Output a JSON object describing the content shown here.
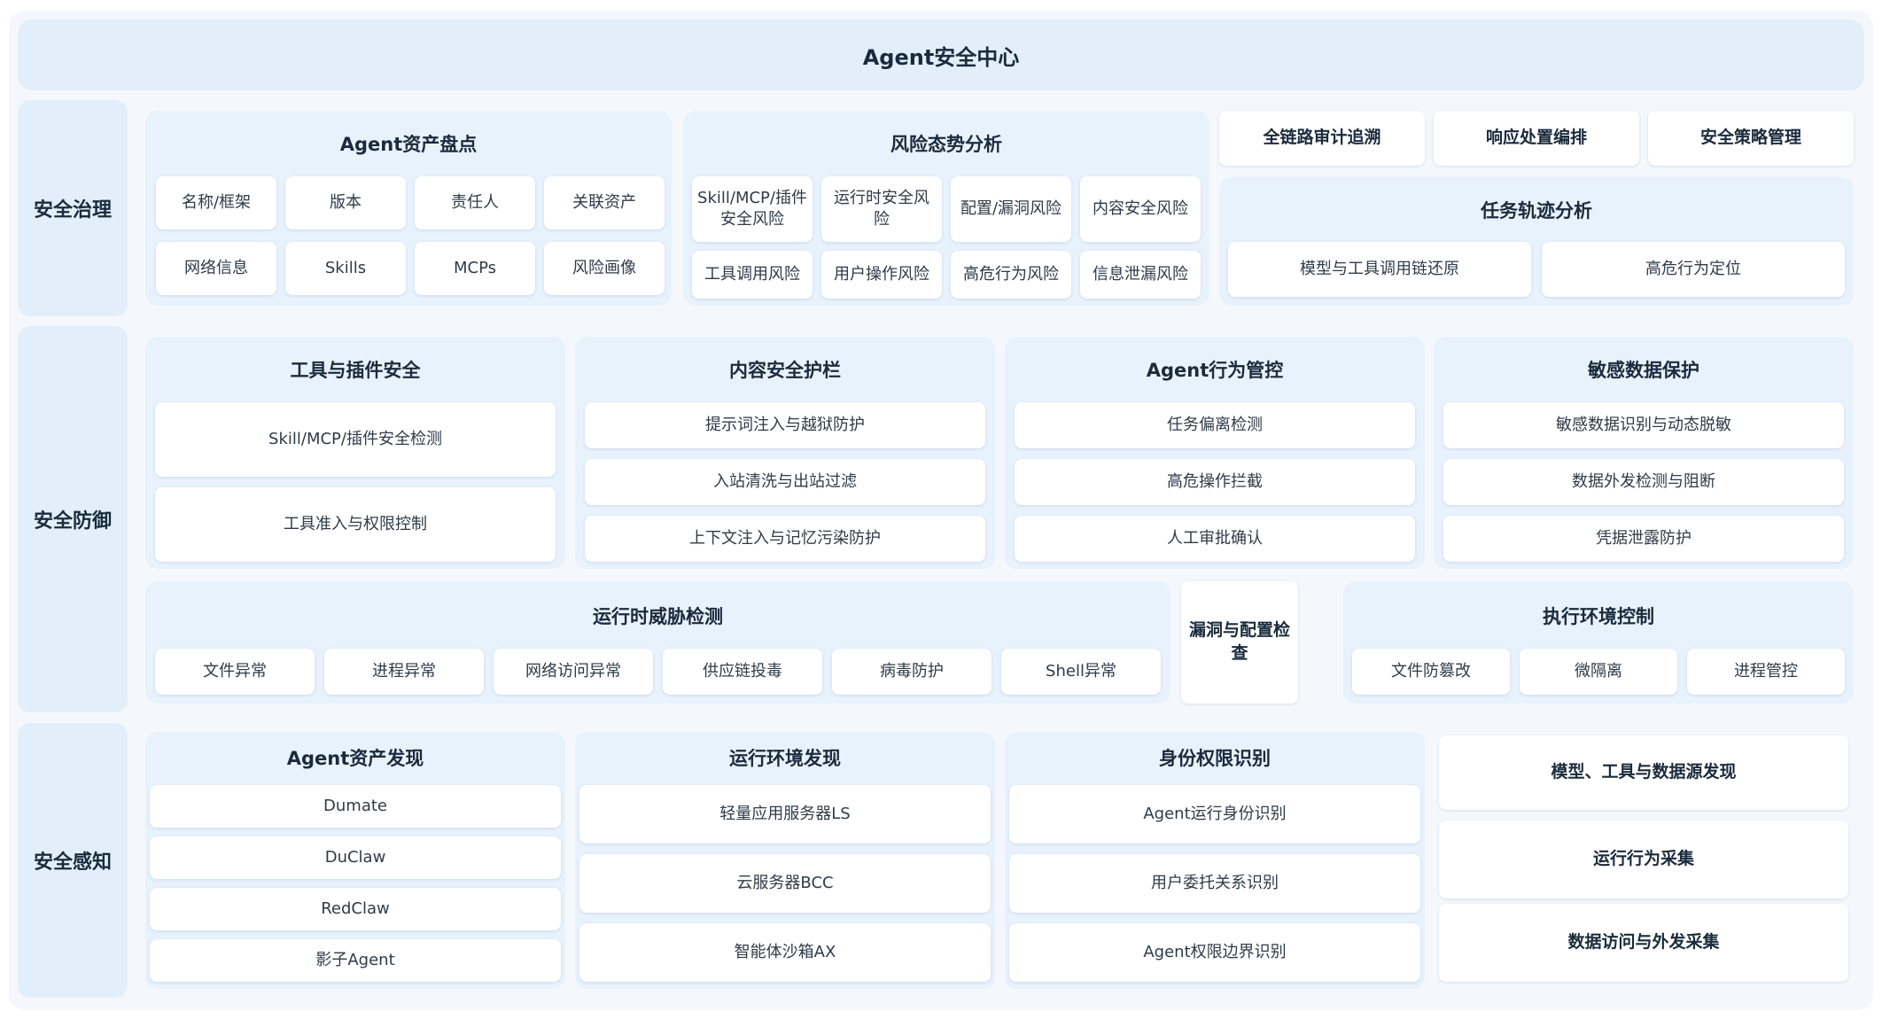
{
  "title": "Agent安全中心",
  "governance": {
    "label": "安全治理",
    "assets": {
      "title": "Agent资产盘点",
      "items": [
        "名称/框架",
        "版本",
        "责任人",
        "关联资产",
        "网络信息",
        "Skills",
        "MCPs",
        "风险画像"
      ]
    },
    "risk": {
      "title": "风险态势分析",
      "items": [
        "Skill/MCP/插件安全风险",
        "运行时安全风险",
        "配置/漏洞风险",
        "内容安全风险",
        "工具调用风险",
        "用户操作风险",
        "高危行为风险",
        "信息泄漏风险"
      ]
    },
    "top_buttons": [
      "全链路审计追溯",
      "响应处置编排",
      "安全策略管理"
    ],
    "trace": {
      "title": "任务轨迹分析",
      "items": [
        "模型与工具调用链还原",
        "高危行为定位"
      ]
    }
  },
  "defense": {
    "label": "安全防御",
    "tools": {
      "title": "工具与插件安全",
      "items": [
        "Skill/MCP/插件安全检测",
        "工具准入与权限控制"
      ]
    },
    "content": {
      "title": "内容安全护栏",
      "items": [
        "提示词注入与越狱防护",
        "入站清洗与出站过滤",
        "上下文注入与记忆污染防护"
      ]
    },
    "behavior": {
      "title": "Agent行为管控",
      "items": [
        "任务偏离检测",
        "高危操作拦截",
        "人工审批确认"
      ]
    },
    "sensitive": {
      "title": "敏感数据保护",
      "items": [
        "敏感数据识别与动态脱敏",
        "数据外发检测与阻断",
        "凭据泄露防护"
      ]
    },
    "runtime": {
      "title": "运行时威胁检测",
      "items": [
        "文件异常",
        "进程异常",
        "网络访问异常",
        "供应链投毒",
        "病毒防护",
        "Shell异常"
      ]
    },
    "vuln": "漏洞与配置检查",
    "env": {
      "title": "执行环境控制",
      "items": [
        "文件防篡改",
        "微隔离",
        "进程管控"
      ]
    }
  },
  "perception": {
    "label": "安全感知",
    "discovery": {
      "title": "Agent资产发现",
      "items": [
        "Dumate",
        "DuClaw",
        "RedClaw",
        "影子Agent"
      ]
    },
    "env_discovery": {
      "title": "运行环境发现",
      "items": [
        "轻量应用服务器LS",
        "云服务器BCC",
        "智能体沙箱AX"
      ]
    },
    "identity": {
      "title": "身份权限识别",
      "items": [
        "Agent运行身份识别",
        "用户委托关系识别",
        "Agent权限边界识别"
      ]
    },
    "collect": [
      "模型、工具与数据源发现",
      "运行行为采集",
      "数据访问与外发采集"
    ]
  }
}
